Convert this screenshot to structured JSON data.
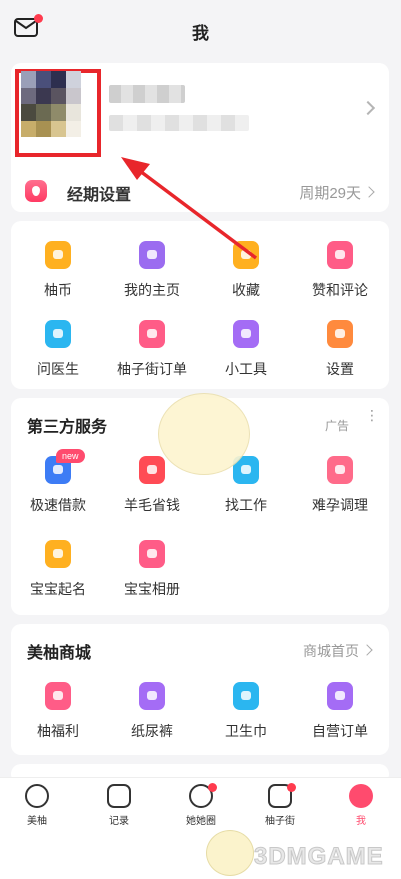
{
  "header": {
    "title": "我",
    "mail_icon": "mail-icon"
  },
  "profile": {
    "period_label": "经期设置",
    "period_value": "周期29天",
    "avatar_mosaic_colors": [
      "#9a9fb8",
      "#4a4f7a",
      "#2d2f4f",
      "#cfd2dc",
      "#6d6a7e",
      "#3b3850",
      "#5a5460",
      "#c9c6cc",
      "#4b4a3f",
      "#6b6a52",
      "#8f8b6a",
      "#e8e5dc",
      "#c7ad6a",
      "#a89152",
      "#d8c590",
      "#f3efe6"
    ]
  },
  "menu": {
    "items": [
      {
        "label": "柚币",
        "icon": "coin-icon",
        "color": "#ffb020"
      },
      {
        "label": "我的主页",
        "icon": "user-icon",
        "color": "#9b6cf0"
      },
      {
        "label": "收藏",
        "icon": "star-icon",
        "color": "#ffb020"
      },
      {
        "label": "赞和评论",
        "icon": "like-icon",
        "color": "#ff5c87"
      },
      {
        "label": "问医生",
        "icon": "medical-cross-icon",
        "color": "#2bb6f0"
      },
      {
        "label": "柚子街订单",
        "icon": "order-icon",
        "color": "#ff5c87"
      },
      {
        "label": "小工具",
        "icon": "tools-icon",
        "color": "#a46cf5"
      },
      {
        "label": "设置",
        "icon": "settings-icon",
        "color": "#ff8a3d"
      }
    ]
  },
  "services": {
    "title": "第三方服务",
    "ad_label": "广告",
    "more": "⋮",
    "new_badge": "new",
    "items": [
      {
        "label": "极速借款",
        "icon": "loan-icon",
        "color": "#3d7cf5",
        "glyph": "借"
      },
      {
        "label": "羊毛省钱",
        "icon": "savings-icon",
        "color": "#ff4b55",
        "glyph": "羊毛"
      },
      {
        "label": "找工作",
        "icon": "briefcase-icon",
        "color": "#2bb6f0",
        "glyph": ""
      },
      {
        "label": "难孕调理",
        "icon": "fertility-icon",
        "color": "#ff6b8a",
        "glyph": ""
      },
      {
        "label": "宝宝起名",
        "icon": "name-card-icon",
        "color": "#ffb020",
        "glyph": ""
      },
      {
        "label": "宝宝相册",
        "icon": "rocking-horse-icon",
        "color": "#ff5c87",
        "glyph": ""
      }
    ]
  },
  "mall": {
    "title": "美柚商城",
    "home_link": "商城首页",
    "items": [
      {
        "label": "柚福利",
        "icon": "gift-icon",
        "color": "#ff5c87"
      },
      {
        "label": "纸尿裤",
        "icon": "diaper-icon",
        "color": "#a46cf5"
      },
      {
        "label": "卫生巾",
        "icon": "pad-icon",
        "color": "#2bb6f0"
      },
      {
        "label": "自营订单",
        "icon": "order-list-icon",
        "color": "#a46cf5"
      }
    ]
  },
  "tabbar": {
    "tabs": [
      {
        "label": "美柚",
        "icon": "meiyou-home-icon"
      },
      {
        "label": "记录",
        "icon": "calendar-icon"
      },
      {
        "label": "她她圈",
        "icon": "community-icon"
      },
      {
        "label": "柚子街",
        "icon": "shop-bag-icon"
      },
      {
        "label": "我",
        "icon": "profile-icon"
      }
    ]
  },
  "watermark": "3DMGAME",
  "colors": {
    "accent": "#ff4b6e",
    "annotation": "#e8262b"
  }
}
